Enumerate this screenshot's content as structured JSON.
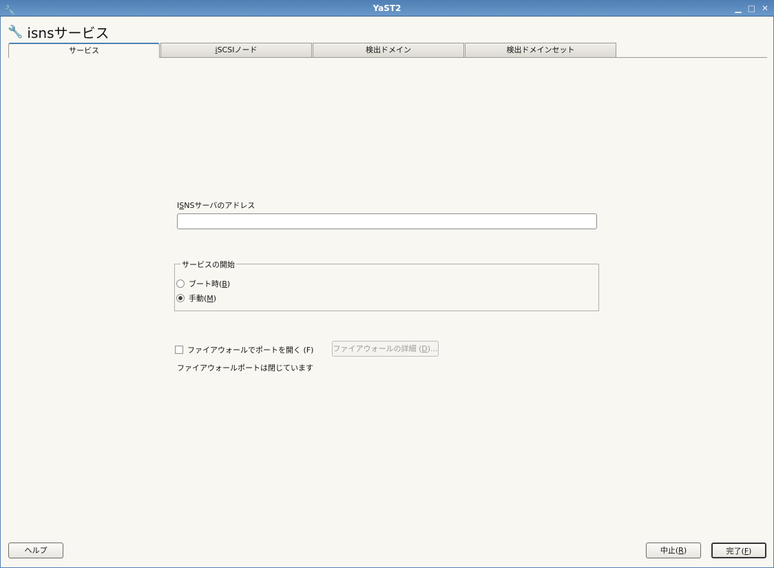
{
  "window": {
    "title": "YaST2",
    "controls": [
      "minimize",
      "maximize",
      "close"
    ]
  },
  "heading": "isnsサービス",
  "tabs": [
    {
      "label": "サービス",
      "active": true
    },
    {
      "label_prefix": "i",
      "label_rest": "SCSIノード"
    },
    {
      "label": "検出ドメイン"
    },
    {
      "label": "検出ドメインセット"
    }
  ],
  "address": {
    "label_pre": "I",
    "label_u": "S",
    "label_post": "NSサーバのアドレス",
    "value": ""
  },
  "startup": {
    "title": "サービスの開始",
    "options": [
      {
        "pre": "ブート時(",
        "u": "B",
        "post": ")",
        "checked": false
      },
      {
        "pre": "手動(",
        "u": "M",
        "post": ")",
        "checked": true
      }
    ]
  },
  "firewall": {
    "checkbox_label": "ファイアウォールでポートを開く (F)",
    "checked": false,
    "details_pre": "ファイアウォールの詳細 (",
    "details_u": "D",
    "details_post": ")...",
    "status": "ファイアウォールポートは閉じています"
  },
  "footer": {
    "help": "ヘルプ",
    "abort_pre": "中止(",
    "abort_u": "R",
    "abort_post": ")",
    "finish_pre": "完了(",
    "finish_u": "F",
    "finish_post": ")"
  }
}
